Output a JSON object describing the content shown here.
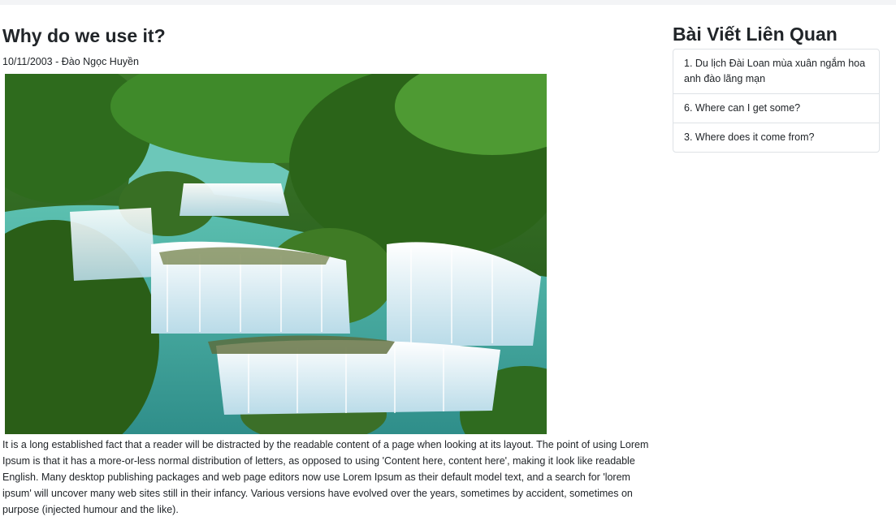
{
  "article": {
    "title": "Why do we use it?",
    "meta": "10/11/2003 - Đào Ngọc Huyền",
    "image_alt": "waterfall-photo",
    "body": "It is a long established fact that a reader will be distracted by the readable content of a page when looking at its layout. The point of using Lorem Ipsum is that it has a more-or-less normal distribution of letters, as opposed to using 'Content here, content here', making it look like readable English. Many desktop publishing packages and web page editors now use Lorem Ipsum as their default model text, and a search for 'lorem ipsum' will uncover many web sites still in their infancy. Various versions have evolved over the years, sometimes by accident, sometimes on purpose (injected humour and the like)."
  },
  "related": {
    "title": "Bài Viết Liên Quan",
    "items": [
      {
        "label": "1. Du lịch Đài Loan mùa xuân ngắm hoa anh đào lãng mạn"
      },
      {
        "label": "6. Where can I get some?"
      },
      {
        "label": "3. Where does it come from?"
      }
    ]
  },
  "colors": {
    "text": "#212529",
    "border": "#dee2e6",
    "topbar": "#f3f4f6",
    "forest": "#2f6b1f",
    "water": "#4fb3a6",
    "waterfall": "#eef6fb"
  }
}
